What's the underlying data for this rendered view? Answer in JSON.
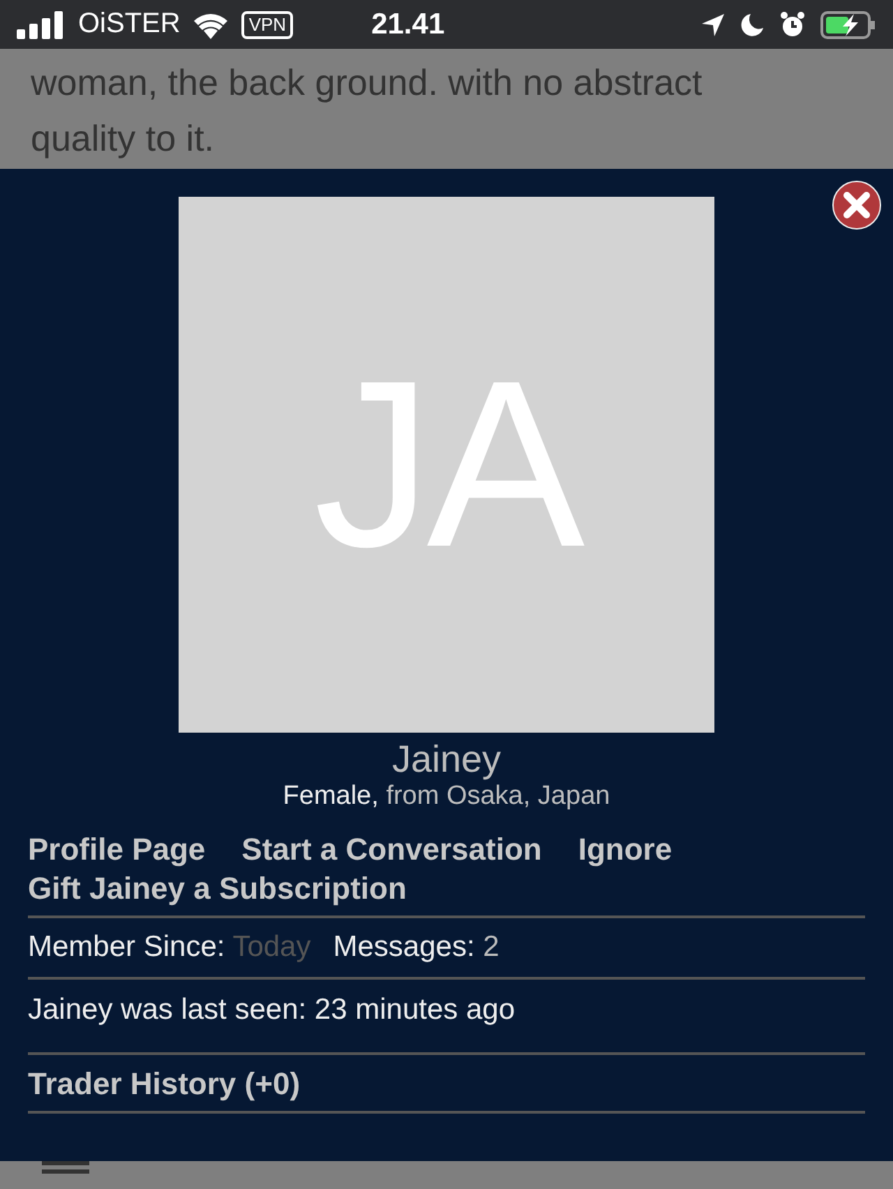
{
  "status_bar": {
    "carrier": "OiSTER",
    "vpn": "VPN",
    "time": "21.41"
  },
  "background": {
    "text": "woman, the back ground. with no abstract quality to it."
  },
  "profile": {
    "initials": "JA",
    "name": "Jainey",
    "gender": "Female,",
    "location": "from Osaka, Japan",
    "links": [
      "Profile Page",
      "Start a Conversation",
      "Ignore",
      "Gift Jainey a Subscription"
    ],
    "member_since_label": "Member Since:",
    "member_since": "Today",
    "messages_label": "Messages:",
    "messages": "2",
    "last_seen": "Jainey was last seen: 23 minutes ago",
    "trader_history": "Trader History (+0)"
  }
}
